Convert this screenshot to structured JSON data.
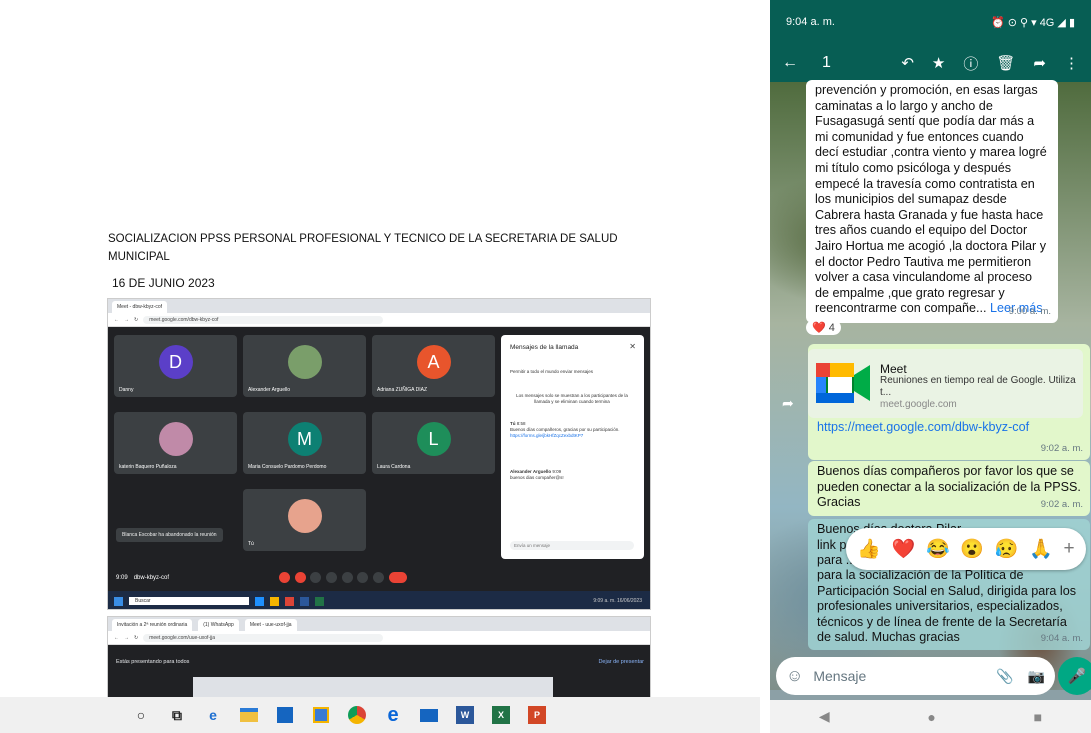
{
  "doc": {
    "title": "SOCIALIZACION PPSS PERSONAL PROFESIONAL Y TECNICO DE LA SECRETARIA DE SALUD MUNICIPAL",
    "date": "16 DE JUNIO 2023"
  },
  "meet1": {
    "tab_title": "Meet - dbw-kbyz-cof",
    "url": "meet.google.com/dbw-kbyz-cof",
    "participants": [
      {
        "name": "Danny",
        "initial": "D",
        "color": "#5b3fc8"
      },
      {
        "name": "Alexander Arguello",
        "initial": "",
        "color": "#7a9e6a"
      },
      {
        "name": "Adriana ZUÑIGA DIAZ",
        "initial": "A",
        "color": "#e8552c"
      },
      {
        "name": "katerin Baquero Puñaloza",
        "initial": "",
        "color": "#c08aa8"
      },
      {
        "name": "Maria Consuelo Pardomo Perdomo",
        "initial": "M",
        "color": "#0d8073"
      },
      {
        "name": "Laura Cardona",
        "initial": "L",
        "color": "#1e8e5a"
      },
      {
        "name": "Tú",
        "initial": "",
        "color": "#e7a38d"
      }
    ],
    "chat": {
      "title": "Mensajes de la llamada",
      "allow": "Permitir a todo el mundo enviar mensajes",
      "notice": "Los mensajes solo se muestran a los participantes de la llamada y se eliminan cuando termina",
      "msg1_author": "Tú",
      "msg1_time": "8:58",
      "msg1_text": "Buenos días compañeros, gracias por su participación.",
      "msg1_link": "https://forms.gle/jbkHfZqcZexbdtKP7",
      "msg2_author": "Alexander Arguello",
      "msg2_time": "9:09",
      "msg2_text": "buenos dias compañer@s!",
      "input_placeholder": "Envía un mensaje"
    },
    "toast": "Blanca Escobar ha abandonado la reunión",
    "clock": "9:09",
    "meeting_code": "dbw-kbyz-cof",
    "search": "Buscar",
    "sys_time": "9:09 a. m.",
    "sys_date": "16/06/2023"
  },
  "meet2": {
    "tab1": "Invitación a 2ª reunión ordinaria",
    "tab2": "(1) WhatsApp",
    "tab3": "Meet - uue-uxof-jja",
    "url": "meet.google.com/uue-uxof-jja",
    "presenting": "Estás presentando para todos",
    "stop": "Dejar de presentar"
  },
  "phone": {
    "status_time": "9:04 a. m.",
    "network": "4G",
    "selection_count": "1",
    "bubble1_text": "prevención y promoción, en esas largas caminatas a lo largo y ancho de Fusagasugá sentí que podía dar más a mi comunidad y fue entonces cuando decí estudiar ,contra viento y marea logré mi título como psicóloga y después empecé la travesía como contratista en los municipios del sumapaz desde Cabrera hasta Granada y fue hasta hace tres años  cuando el equipo del Doctor Jairo Hortua me acogió ,la doctora Pilar y el doctor Pedro Tautiva me permitieron volver a casa vinculandome al proceso de empalme ,que grato regresar y reencontrarme con compañe...",
    "bubble1_more": "Leer más",
    "bubble1_time": "9:00 a. m.",
    "reaction_emoji": "❤️",
    "reaction_count": "4",
    "link_title": "Meet",
    "link_desc": "Reuniones en tiempo real de Google. Utiliza t...",
    "link_domain": "meet.google.com",
    "link_url": "https://meet.google.com/dbw-kbyz-cof",
    "link_time": "9:02 a. m.",
    "msg2_text": "Buenos días compañeros por favor los que se pueden conectar a la socialización de la PPSS. Gracias",
    "msg2_time": "9:02 a. m.",
    "msg3_line1": "Buenos días doctora Pilar ...",
    "msg3_line2": "link p...",
    "msg3_line3": "para ...",
    "msg3_rest": "para la socialización de la Política de Participación Social en Salud, dirigida para los profesionales universitarios, especializados, técnicos y de línea de frente de la Secretaría de salud. Muchas gracias",
    "msg3_time": "9:04 a. m.",
    "emoji_reactions": [
      "👍",
      "❤️",
      "😂",
      "😮",
      "😥",
      "🙏",
      "+"
    ],
    "input_placeholder": "Mensaje",
    "colors": {
      "header": "#075e54",
      "accent": "#00a884"
    }
  }
}
